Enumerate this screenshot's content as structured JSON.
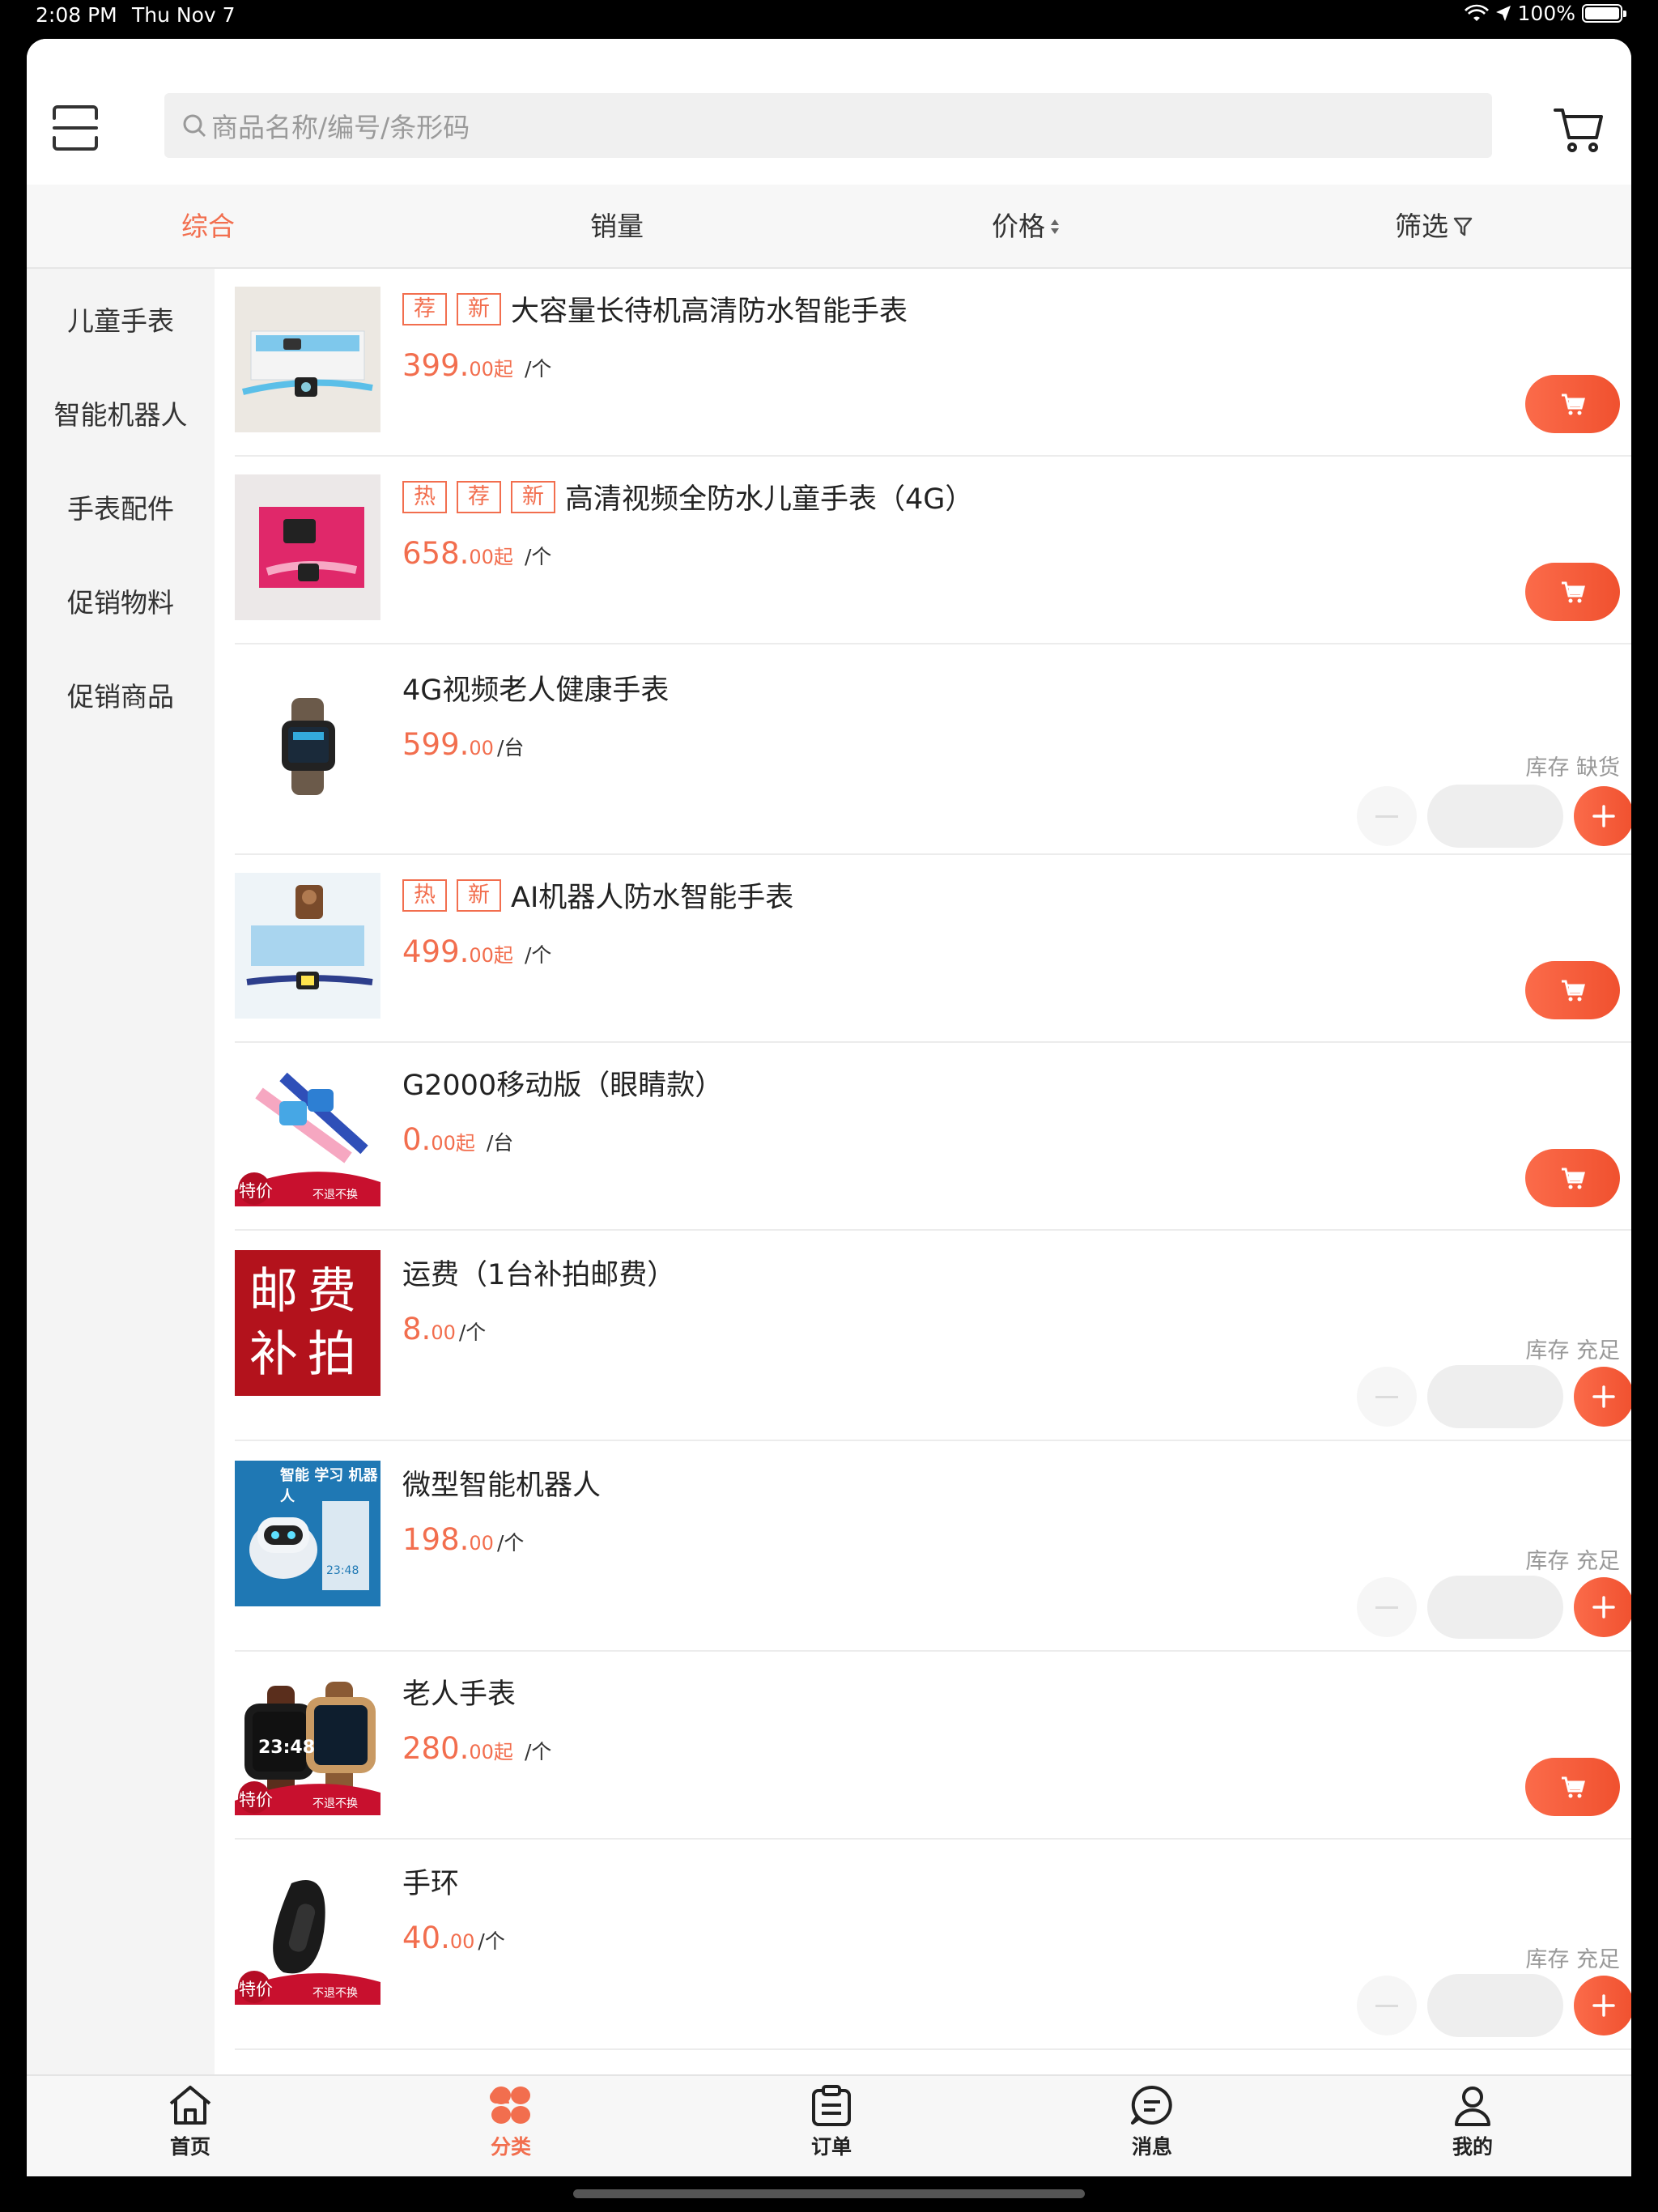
{
  "status": {
    "time": "2:08 PM",
    "date": "Thu Nov 7",
    "battery": "100%"
  },
  "search": {
    "placeholder": "商品名称/编号/条形码"
  },
  "sort": {
    "comprehensive": "综合",
    "sales": "销量",
    "price": "价格",
    "filter": "筛选"
  },
  "categories": [
    "儿童手表",
    "智能机器人",
    "手表配件",
    "促销物料",
    "促销商品"
  ],
  "products": [
    {
      "tags": [
        "荐",
        "新"
      ],
      "title": "大容量长待机高清防水智能手表",
      "price_int": "399.",
      "price_dec": "00起",
      "unit": "/个",
      "action": "cart",
      "thumb": "watch-blue-box"
    },
    {
      "tags": [
        "热",
        "荐",
        "新"
      ],
      "title": "高清视频全防水儿童手表（4G）",
      "price_int": "658.",
      "price_dec": "00起",
      "unit": "/个",
      "action": "cart",
      "thumb": "watch-pink-box"
    },
    {
      "tags": [],
      "title": "4G视频老人健康手表",
      "price_int": "599.",
      "price_dec": "00",
      "unit": "/台",
      "action": "stepper",
      "stock": "库存 缺货",
      "thumb": "watch-black"
    },
    {
      "tags": [
        "热",
        "新"
      ],
      "title": "AI机器人防水智能手表",
      "price_int": "499.",
      "price_dec": "00起",
      "unit": "/个",
      "action": "cart",
      "thumb": "watch-robot-box"
    },
    {
      "tags": [],
      "title": "G2000移动版（眼睛款）",
      "price_int": "0.",
      "price_dec": "00起",
      "unit": "/台",
      "action": "cart",
      "thumb": "watch-pair-sale",
      "badge": "特价",
      "ribbon": "不退不换"
    },
    {
      "tags": [],
      "title": "运费（1台补拍邮费）",
      "price_int": "8.",
      "price_dec": "00",
      "unit": "/个",
      "action": "stepper",
      "stock": "库存 充足",
      "thumb": "postage",
      "postage_text": [
        "邮",
        "费",
        "补",
        "拍"
      ]
    },
    {
      "tags": [],
      "title": "微型智能机器人",
      "price_int": "198.",
      "price_dec": "00",
      "unit": "/个",
      "action": "stepper",
      "stock": "库存 充足",
      "thumb": "robot",
      "robot_text": "智能 学习 机器人",
      "robot_clock": "23:48"
    },
    {
      "tags": [],
      "title": "老人手表",
      "price_int": "280.",
      "price_dec": "00起",
      "unit": "/个",
      "action": "cart",
      "thumb": "watch-elder-sale",
      "badge": "特价",
      "ribbon": "不退不换",
      "watch_time": "23:48"
    },
    {
      "tags": [],
      "title": "手环",
      "price_int": "40.",
      "price_dec": "00",
      "unit": "/个",
      "action": "stepper",
      "stock": "库存 充足",
      "thumb": "band-sale",
      "badge": "特价",
      "ribbon": "不退不换"
    }
  ],
  "tabs": [
    {
      "label": "首页",
      "icon": "home-icon"
    },
    {
      "label": "分类",
      "icon": "category-icon",
      "active": true
    },
    {
      "label": "订单",
      "icon": "order-icon"
    },
    {
      "label": "消息",
      "icon": "message-icon"
    },
    {
      "label": "我的",
      "icon": "profile-icon"
    }
  ],
  "colors": {
    "accent": "#f26e4e",
    "sidebar": "#f4f4f4",
    "tabbar": "#f7f7f7"
  }
}
